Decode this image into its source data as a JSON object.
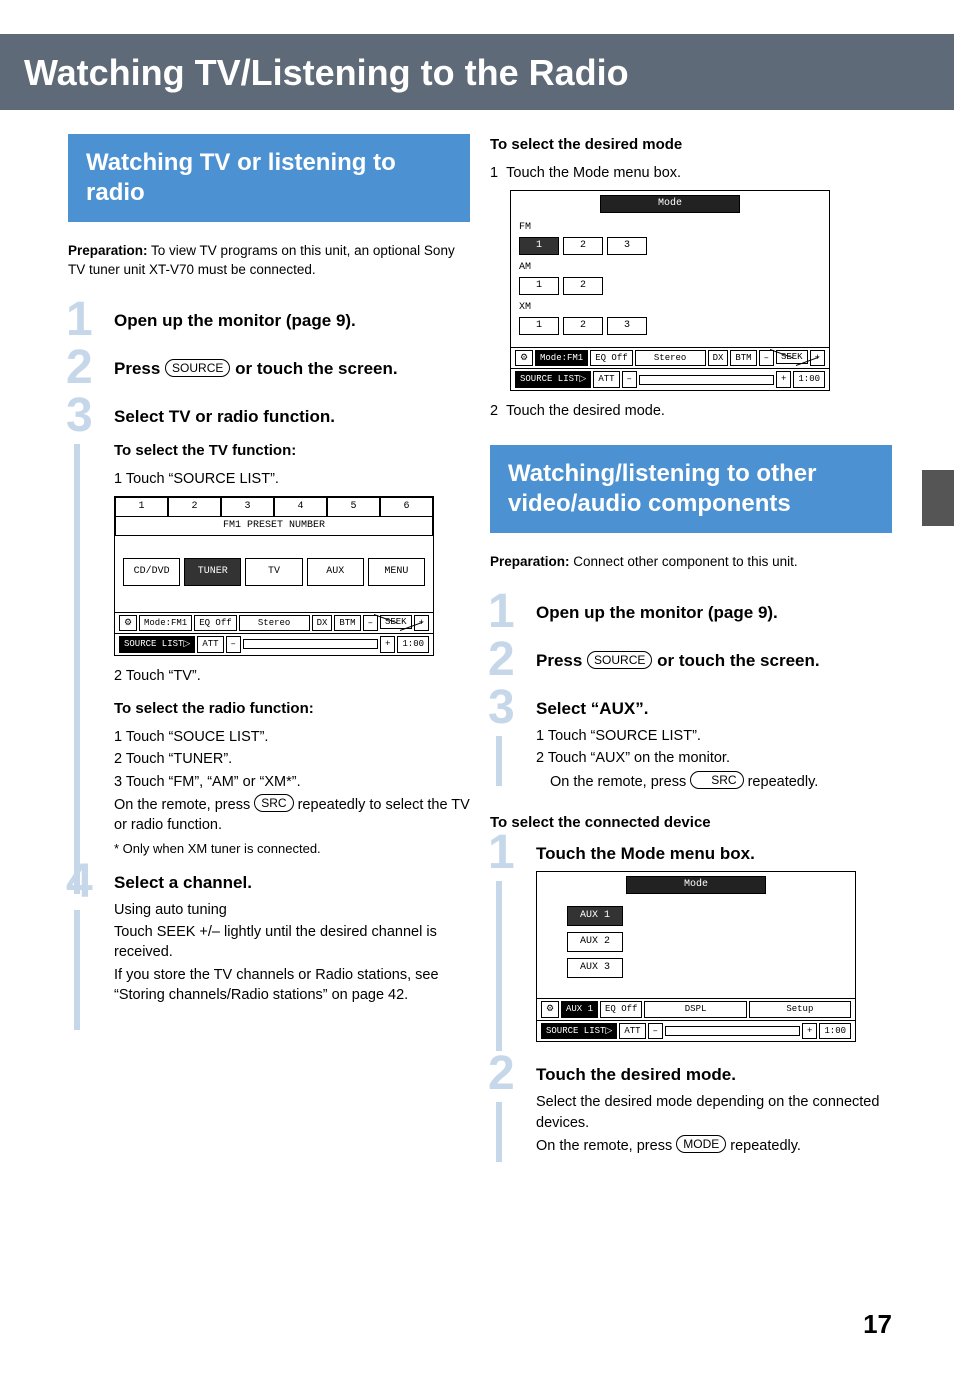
{
  "page_title": "Watching TV/Listening to the Radio",
  "page_number": "17",
  "left": {
    "section_title": "Watching TV or listening to radio",
    "prep_label": "Preparation:",
    "prep_text": " To view TV programs on this unit, an optional Sony TV tuner unit XT-V70 must be connected.",
    "step1": "Open up the monitor (page 9).",
    "step2_a": "Press ",
    "step2_key": "SOURCE",
    "step2_b": " or touch the screen.",
    "step3_title": "Select TV or radio function.",
    "tv_heading": "To select the TV function:",
    "tv_step1": "1 Touch “SOURCE LIST”.",
    "tv_step2": "2 Touch “TV”.",
    "radio_heading": "To select the radio function:",
    "radio_step1": "1 Touch “SOUCE LIST”.",
    "radio_step2": "2 Touch “TUNER”.",
    "radio_step3": "3 Touch “FM”, “AM” or “XM*”.",
    "radio_remote_a": "On the remote, press ",
    "radio_remote_key": "SRC",
    "radio_remote_b": " repeatedly to select the TV or radio function.",
    "radio_footnote": "* Only when XM tuner is connected.",
    "step4_title": "Select a channel.",
    "auto_tuning": "Using auto tuning",
    "auto_body": "Touch SEEK +/– lightly until the desired channel is received.",
    "store_body": "If you store the TV channels or Radio stations, see “Storing channels/Radio stations” on page 42."
  },
  "right": {
    "mode_heading": "To select the desired mode",
    "mode_step1": "Touch the Mode menu box.",
    "mode_step2": "Touch the desired mode.",
    "section_title": "Watching/listening to other video/audio components",
    "prep_label": "Preparation:",
    "prep_text": " Connect other component to this unit.",
    "step1": "Open up the monitor (page 9).",
    "step2_a": "Press ",
    "step2_key": "SOURCE",
    "step2_b": " or touch the screen.",
    "step3_title": "Select “AUX”.",
    "aux_s1": "1 Touch “SOURCE LIST”.",
    "aux_s2": "2 Touch “AUX” on the monitor.",
    "aux_remote_a": "On the remote, press ",
    "aux_remote_key": "SRC",
    "aux_remote_b": " repeatedly.",
    "conn_heading": "To select the connected device",
    "c_step1": "Touch the Mode menu box.",
    "c_step2_title": "Touch the desired mode.",
    "c_step2_body": "Select the desired mode depending on the connected devices.",
    "c_step2_remote_a": "On the remote, press ",
    "c_step2_remote_key": "MODE",
    "c_step2_remote_b": " repeatedly."
  },
  "ui": {
    "preset_nums": [
      "1",
      "2",
      "3",
      "4",
      "5",
      "6"
    ],
    "preset_label": "FM1 PRESET NUMBER",
    "sources": [
      "CD/DVD",
      "TUNER",
      "TV",
      "AUX",
      "MENU"
    ],
    "source_list": "SOURCE LIST▷",
    "att": "ATT",
    "minus": "–",
    "plus": "+",
    "clock": "1:00",
    "mode_box": "Mode:FM1",
    "eq": "EQ Off",
    "stereo": "Stereo",
    "dx": "DX",
    "btm": "BTM",
    "seek": "SEEK",
    "mode_title": "Mode",
    "bands": {
      "FM": [
        "1",
        "2",
        "3"
      ],
      "AM": [
        "1",
        "2"
      ],
      "XM": [
        "1",
        "2",
        "3"
      ]
    },
    "aux_mode_sel": "AUX 1",
    "aux_modes": [
      "AUX 1",
      "AUX 2",
      "AUX 3"
    ],
    "dspl": "DSPL",
    "setup": "Setup",
    "gear": "⚙"
  }
}
